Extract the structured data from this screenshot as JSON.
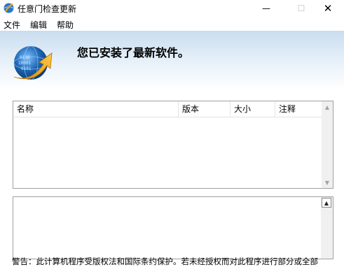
{
  "window": {
    "title": "任意门检查更新",
    "minimize_glyph": "—",
    "maximize_glyph": "☐",
    "close_glyph": "✕"
  },
  "menu": {
    "items": [
      "文件",
      "编辑",
      "帮助"
    ]
  },
  "header": {
    "icon": "globe-update-icon",
    "message": "您已安装了最新软件。"
  },
  "updates_table": {
    "columns": [
      "名称",
      "版本",
      "大小",
      "注释"
    ],
    "rows": [],
    "scroll_up": "▲",
    "scroll_down": "▼"
  },
  "details": {
    "text": "",
    "scroll_up": "▲"
  },
  "footer": {
    "warning": "警告：此计算机程序受版权法和国际条约保护。若未经授权而对此程序进行部分或全部"
  },
  "colors": {
    "header_gradient_top": "#c9dcef",
    "arrow_orange": "#f0a21e",
    "globe_blue": "#1b63b0"
  }
}
